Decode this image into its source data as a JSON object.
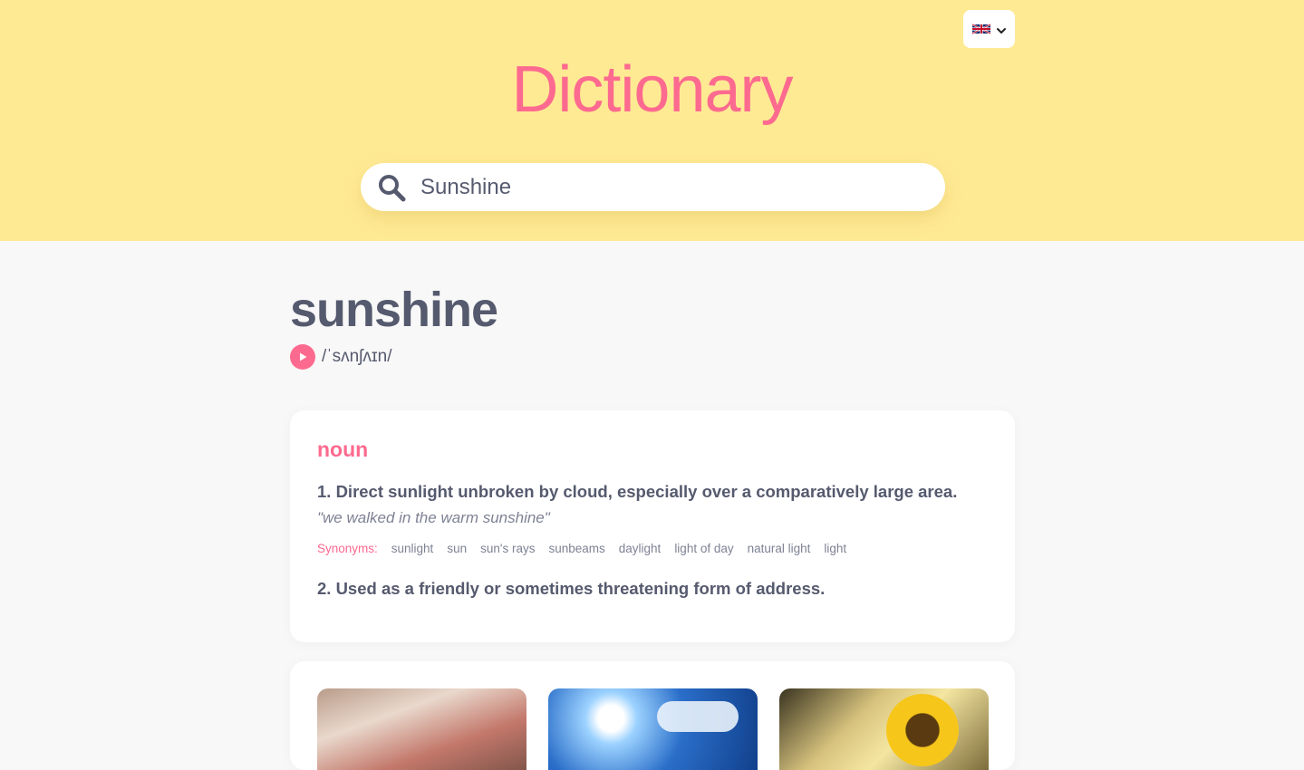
{
  "header": {
    "title": "Dictionary",
    "language": {
      "icon": "uk-flag-icon",
      "dropdown_icon": "chevron-down-icon"
    },
    "search": {
      "value": "Sunshine",
      "placeholder": "",
      "icon": "search-icon"
    }
  },
  "entry": {
    "word": "sunshine",
    "phonetic": "/ˈsʌnʃʌɪn/",
    "audio_icon": "play-icon",
    "meanings": [
      {
        "part_of_speech": "noun",
        "definitions": [
          {
            "text": "1. Direct sunlight unbroken by cloud, especially over a comparatively large area.",
            "example": "\"we walked in the warm sunshine\"",
            "synonyms_label": "Synonyms:",
            "synonyms": [
              "sunlight",
              "sun",
              "sun's rays",
              "sunbeams",
              "daylight",
              "light of day",
              "natural light",
              "light"
            ]
          },
          {
            "text": "2. Used as a friendly or sometimes threatening form of address."
          }
        ]
      }
    ]
  },
  "images": [
    "sunlight-photo",
    "sky-sun-photo",
    "sunflower-photo"
  ],
  "colors": {
    "header_bg": "#ffea94",
    "accent": "#fd6a8f",
    "text": "#555a6e",
    "muted": "#7e8294",
    "page_bg": "#f8f8f8"
  }
}
